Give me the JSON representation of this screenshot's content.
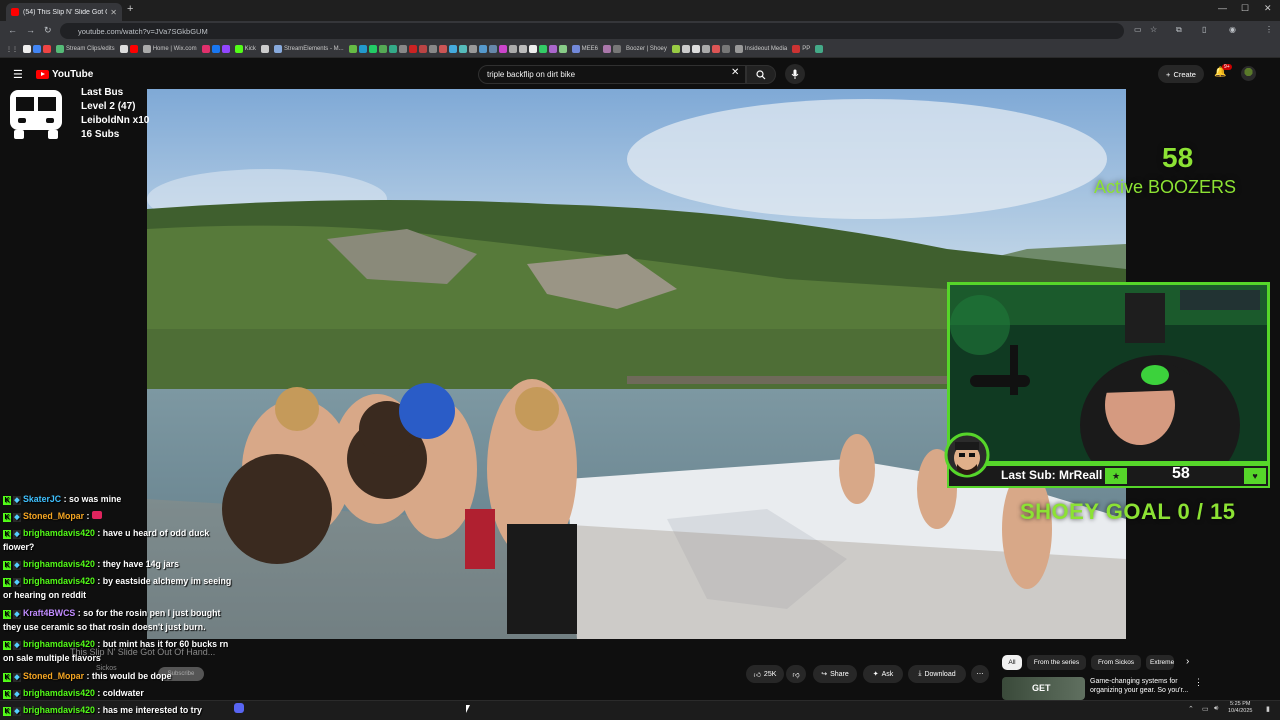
{
  "browser": {
    "tab_title": "(54) This Slip N' Slide Got O",
    "url": "youtube.com/watch?v=JVa7SGkbGUM",
    "bookmarks": [
      {
        "label": "Stream Clips/edits",
        "color": "#5b7"
      },
      {
        "label": "Home | Wix.com",
        "color": "#aaa"
      },
      {
        "label": "Kick",
        "color": "#53fc18"
      },
      {
        "label": "StreamElements - M...",
        "color": "#8ad"
      },
      {
        "label": "MEE6",
        "color": "#7289da"
      },
      {
        "label": "Boozer | Shoey",
        "color": "#caa"
      },
      {
        "label": "Insideout Media",
        "color": "#999"
      },
      {
        "label": "PP",
        "color": "#c33"
      }
    ]
  },
  "youtube": {
    "logo_text": "YouTube",
    "search_query": "triple backflip on dirt bike",
    "create_label": "Create",
    "notification_badge": "9+"
  },
  "overlay": {
    "bus": {
      "line1": "Last Bus",
      "line2": "Level 2  (47)",
      "line3": "LeiboldNn x10",
      "line4": "16 Subs"
    },
    "active_count": "58",
    "active_label": "Active BOOZERS",
    "last_sub": "Last Sub: MrReall",
    "sub_count": "58",
    "goal": "SHOEY   GOAL  0 / 15"
  },
  "chat": [
    {
      "user": "SkaterJC",
      "color": "#3fc1ff",
      "text": " : so was mine",
      "cont": ""
    },
    {
      "user": "Stoned_Mopar",
      "color": "#f5a623",
      "text": " : ",
      "cont": ""
    },
    {
      "user": "brighamdavis420",
      "color": "#53fc18",
      "text": " : have u heard of odd duck",
      "cont": "flower?"
    },
    {
      "user": "brighamdavis420",
      "color": "#53fc18",
      "text": " : they have 14g jars",
      "cont": ""
    },
    {
      "user": "brighamdavis420",
      "color": "#53fc18",
      "text": " : by eastside alchemy im seeing",
      "cont": "or hearing on reddit"
    },
    {
      "user": "Kraft4BWCS",
      "color": "#c18cff",
      "text": " : so for the rosin pen I just bought",
      "cont": "they use ceramic so that rosin doesn't just burn."
    },
    {
      "user": "brighamdavis420",
      "color": "#53fc18",
      "text": " : but mint has it for 60 bucks rn",
      "cont": "on sale multiple flavors"
    },
    {
      "user": "Stoned_Mopar",
      "color": "#f5a623",
      "text": " : this would be dope",
      "cont": ""
    },
    {
      "user": "brighamdavis420",
      "color": "#53fc18",
      "text": " : coldwater",
      "cont": ""
    },
    {
      "user": "brighamdavis420",
      "color": "#53fc18",
      "text": " : has me interested to try",
      "cont": ""
    }
  ],
  "video_info": {
    "title": "This Slip N' Slide Got Out Of Hand...",
    "channel": "Sickos",
    "subscribe_label": "Subscribe",
    "like_count": "25K",
    "share_label": "Share",
    "ask_label": "Ask",
    "download_label": "Download"
  },
  "chips": [
    "All",
    "From the series",
    "From Sickos",
    "Extreme"
  ],
  "recommendation": {
    "thumb_text": "GET",
    "title": "Game-changing systems for organizing your gear. So you'r..."
  },
  "taskbar": {
    "time": "5:25 PM",
    "date": "10/4/2025"
  }
}
